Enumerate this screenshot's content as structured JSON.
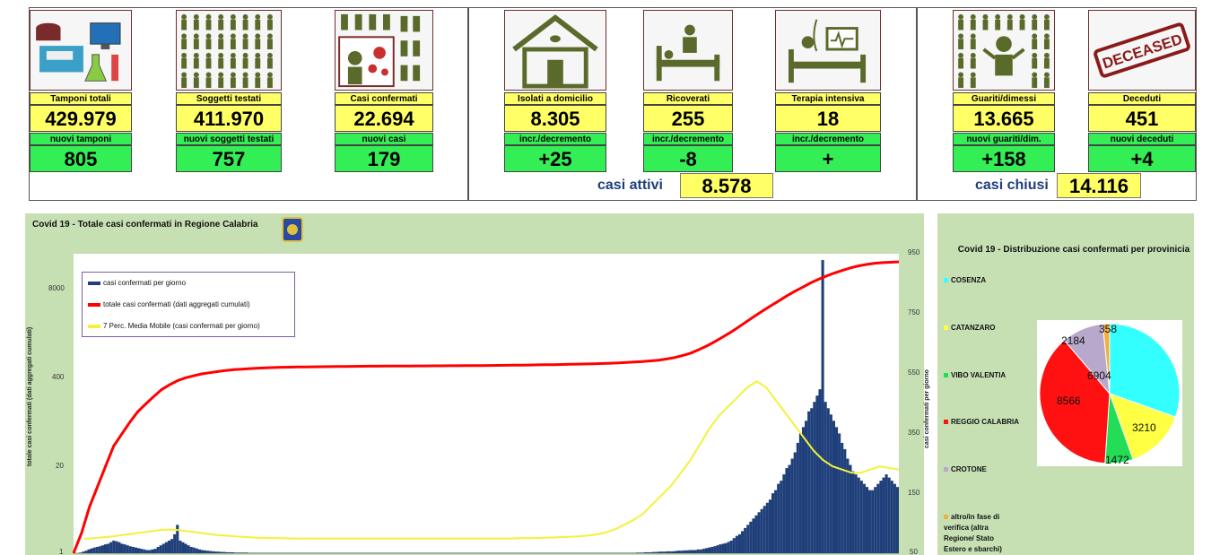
{
  "stats": {
    "tamponi": {
      "label": "Tamponi totali",
      "value": "429.979",
      "sub_label": "nuovi tamponi",
      "sub_value": "805"
    },
    "soggetti": {
      "label": "Soggetti testati",
      "value": "411.970",
      "sub_label": "nuovi soggetti testati",
      "sub_value": "757"
    },
    "casi": {
      "label": "Casi confermati",
      "value": "22.694",
      "sub_label": "nuovi casi",
      "sub_value": "179"
    },
    "isolati": {
      "label": "Isolati a domicilio",
      "value": "8.305",
      "sub_label": "incr./decremento",
      "sub_value": "+25"
    },
    "ricoverati": {
      "label": "Ricoverati",
      "value": "255",
      "sub_label": "incr./decremento",
      "sub_value": "-8"
    },
    "terapia": {
      "label": "Terapia intensiva",
      "value": "18",
      "sub_label": "incr./decremento",
      "sub_value": "+"
    },
    "guariti": {
      "label": "Guariti/dimessi",
      "value": "13.665",
      "sub_label": "nuovi guariti/dim.",
      "sub_value": "+158"
    },
    "deceduti": {
      "label": "Deceduti",
      "value": "451",
      "sub_label": "nuovi deceduti",
      "sub_value": "+4"
    }
  },
  "summary": {
    "attivi_label": "casi attivi",
    "attivi_value": "8.578",
    "chiusi_label": "casi chiusi",
    "chiusi_value": "14.116"
  },
  "icons": {
    "deceased_stamp_text": "DECEASED"
  },
  "colors": {
    "cumulative": "#ff0000",
    "daily_bar": "#1f3f7a",
    "moving_avg": "#f2f23a",
    "panel_bg": "#c6e0b4"
  },
  "chart_data": [
    {
      "type": "bar",
      "title": "Covid 19 - Totale casi confermati in Regione Calabria",
      "ylabel_left": "totale casi confermati (dati aggregati cumulati)",
      "ylabel_right": "casi confermati per giorno",
      "yticks_left": [
        "1",
        "20",
        "400",
        "8000"
      ],
      "yticks_right": [
        "50",
        "150",
        "350",
        "550",
        "750",
        "950"
      ],
      "y_left_scale": "log",
      "legend_position": "top-left",
      "series": [
        {
          "name": "casi confermati per giorno",
          "type": "bar",
          "values": [
            0,
            0,
            2,
            5,
            8,
            12,
            15,
            18,
            20,
            22,
            25,
            28,
            30,
            35,
            40,
            38,
            35,
            30,
            28,
            25,
            22,
            20,
            18,
            16,
            14,
            12,
            10,
            10,
            12,
            14,
            20,
            25,
            30,
            35,
            40,
            45,
            60,
            90,
            40,
            35,
            30,
            25,
            20,
            18,
            15,
            12,
            10,
            9,
            8,
            7,
            6,
            5,
            5,
            4,
            4,
            3,
            3,
            3,
            2,
            2,
            2,
            2,
            2,
            1,
            1,
            1,
            1,
            1,
            1,
            1,
            1,
            1,
            1,
            1,
            1,
            1,
            1,
            1,
            1,
            1,
            1,
            1,
            1,
            1,
            1,
            1,
            1,
            1,
            1,
            1,
            1,
            1,
            1,
            1,
            1,
            1,
            1,
            1,
            1,
            1,
            1,
            1,
            1,
            1,
            1,
            1,
            1,
            1,
            1,
            1,
            1,
            1,
            1,
            1,
            1,
            1,
            1,
            1,
            1,
            1,
            1,
            1,
            1,
            1,
            1,
            1,
            1,
            1,
            1,
            1,
            1,
            1,
            1,
            1,
            1,
            1,
            1,
            1,
            1,
            1,
            1,
            1,
            1,
            1,
            1,
            1,
            1,
            1,
            1,
            1,
            1,
            1,
            1,
            1,
            1,
            1,
            1,
            1,
            1,
            1,
            1,
            1,
            1,
            1,
            1,
            1,
            1,
            1,
            1,
            1,
            1,
            1,
            1,
            1,
            1,
            1,
            1,
            1,
            1,
            1,
            1,
            1,
            1,
            1,
            1,
            1,
            1,
            1,
            1,
            1,
            1,
            1,
            1,
            1,
            1,
            1,
            1,
            1,
            1,
            1,
            1,
            1,
            1,
            2,
            2,
            2,
            3,
            3,
            3,
            4,
            4,
            5,
            5,
            5,
            6,
            6,
            6,
            7,
            8,
            8,
            9,
            9,
            10,
            10,
            10,
            12,
            12,
            14,
            16,
            18,
            20,
            22,
            25,
            28,
            30,
            32,
            36,
            40,
            48,
            55,
            60,
            70,
            80,
            90,
            100,
            110,
            120,
            130,
            140,
            150,
            160,
            170,
            190,
            200,
            220,
            230,
            250,
            270,
            280,
            300,
            320,
            350,
            380,
            400,
            420,
            450,
            460,
            480,
            500,
            520,
            930,
            480,
            460,
            440,
            420,
            400,
            380,
            350,
            330,
            300,
            280,
            260,
            250,
            240,
            230,
            220,
            210,
            200,
            200,
            210,
            220,
            230,
            240,
            250,
            240,
            230,
            220,
            210
          ],
          "note_peak": 930
        },
        {
          "name": "totale casi confermati (dati aggregati cumulati)",
          "type": "line",
          "values": [
            1,
            2,
            5,
            10,
            20,
            40,
            60,
            90,
            130,
            170,
            220,
            280,
            330,
            380,
            420,
            450,
            480,
            500,
            520,
            540,
            555,
            565,
            575,
            585,
            592,
            598,
            602,
            605,
            608,
            610,
            612,
            614,
            616,
            618,
            620,
            622,
            624,
            625,
            626,
            627,
            628,
            629,
            630,
            631,
            632,
            633,
            634,
            635,
            636,
            637,
            638,
            640,
            642,
            644,
            646,
            648,
            650,
            652,
            655,
            658,
            660,
            664,
            668,
            672,
            676,
            680,
            686,
            692,
            700,
            710,
            720,
            735,
            750,
            770,
            800,
            840,
            900,
            980,
            1100,
            1250,
            1450,
            1700,
            2000,
            2400,
            2900,
            3500,
            4200,
            5000,
            5900,
            7000,
            8200,
            9500,
            11000,
            12500,
            14000,
            15500,
            17000,
            18500,
            19800,
            20800,
            21600,
            22100,
            22400,
            22694
          ]
        },
        {
          "name": "7 Perc. Media Mobile (casi confermati per giorno)",
          "type": "line",
          "values": [
            0,
            2,
            5,
            8,
            12,
            16,
            20,
            24,
            28,
            30,
            28,
            24,
            20,
            16,
            12,
            10,
            8,
            6,
            4,
            3,
            2,
            2,
            1,
            1,
            1,
            1,
            1,
            1,
            1,
            1,
            1,
            1,
            1,
            1,
            1,
            1,
            1,
            1,
            1,
            1,
            1,
            1,
            1,
            1,
            1,
            1,
            2,
            2,
            3,
            4,
            5,
            6,
            8,
            10,
            14,
            20,
            30,
            45,
            60,
            80,
            110,
            140,
            170,
            210,
            250,
            300,
            350,
            390,
            420,
            450,
            480,
            500,
            480,
            440,
            400,
            360,
            320,
            280,
            250,
            230,
            220,
            210,
            210,
            220,
            230,
            225,
            220
          ]
        }
      ]
    },
    {
      "type": "pie",
      "title": "Covid 19 - Distribuzione casi confermati per provinicia",
      "legend_position": "left",
      "slices": [
        {
          "name": "COSENZA",
          "value": 6904,
          "color": "#33ffff"
        },
        {
          "name": "CATANZARO",
          "value": 3210,
          "color": "#ffff44"
        },
        {
          "name": "VIBO VALENTIA",
          "value": 1472,
          "color": "#22dd55"
        },
        {
          "name": "REGGIO CALABRIA",
          "value": 8566,
          "color": "#ff1111"
        },
        {
          "name": "CROTONE",
          "value": 2184,
          "color": "#b8a8cc"
        },
        {
          "name": "altro/in fase di verifica (altra Regione/ Stato Estero e sbarchi)",
          "value": 358,
          "color": "#f0b040"
        }
      ]
    }
  ]
}
